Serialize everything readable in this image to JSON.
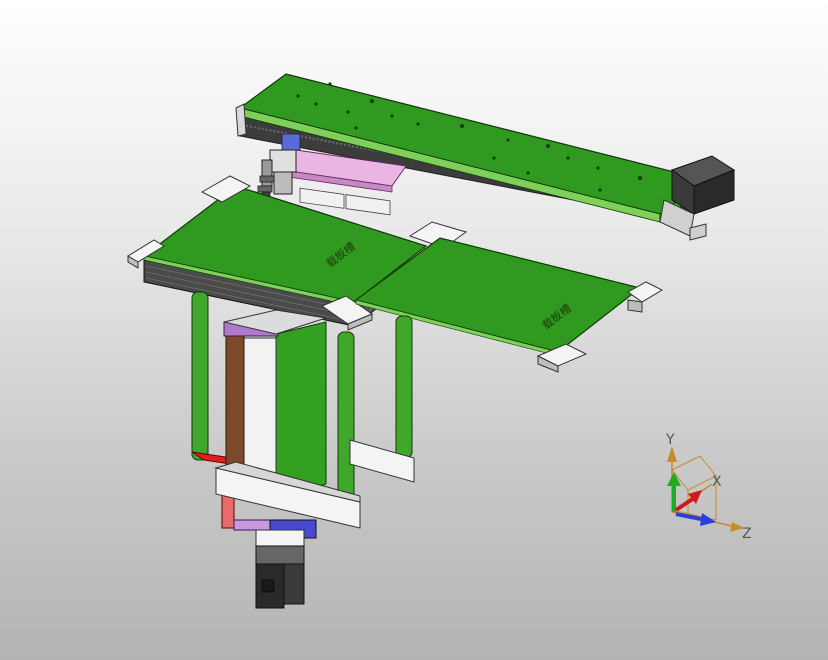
{
  "model": {
    "board_label_left": "载板槽",
    "board_label_right": "载板槽"
  },
  "triad": {
    "x_label": "X",
    "y_label": "Y",
    "z_label": "Z"
  },
  "colors": {
    "board_green": "#2f9a1f",
    "rail_green": "#3fa82a",
    "metal_white": "#ececec",
    "motor_black": "#2a2a2a",
    "belt_dark": "#3c3c3c",
    "axis_red": "#d01a1a",
    "axis_green": "#22aa22",
    "axis_blue": "#2a3fd8",
    "axis_orange": "#c88a2a"
  }
}
